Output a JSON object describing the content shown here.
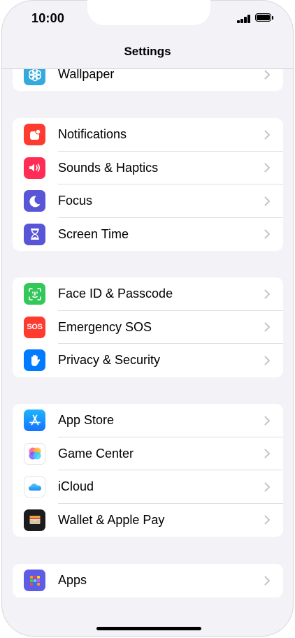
{
  "status_bar": {
    "time": "10:00"
  },
  "header": {
    "title": "Settings"
  },
  "groups": [
    {
      "rows": [
        {
          "label": "Wallpaper",
          "icon": "wallpaper-icon",
          "color": "#34aadc"
        }
      ]
    },
    {
      "rows": [
        {
          "label": "Notifications",
          "icon": "notifications-icon",
          "color": "#ff3b30"
        },
        {
          "label": "Sounds & Haptics",
          "icon": "speaker-icon",
          "color": "#ff2d55"
        },
        {
          "label": "Focus",
          "icon": "moon-icon",
          "color": "#5856d6"
        },
        {
          "label": "Screen Time",
          "icon": "hourglass-icon",
          "color": "#5856d6"
        }
      ]
    },
    {
      "rows": [
        {
          "label": "Face ID & Passcode",
          "icon": "face-id-icon",
          "color": "#34c759"
        },
        {
          "label": "Emergency SOS",
          "icon": "sos-icon",
          "color": "#ff3b30",
          "icon_text": "SOS"
        },
        {
          "label": "Privacy & Security",
          "icon": "hand-icon",
          "color": "#007aff"
        }
      ]
    },
    {
      "rows": [
        {
          "label": "App Store",
          "icon": "app-store-icon",
          "color": "#1a8cff"
        },
        {
          "label": "Game Center",
          "icon": "game-center-icon",
          "color": "#ffffff"
        },
        {
          "label": "iCloud",
          "icon": "icloud-icon",
          "color": "#ffffff"
        },
        {
          "label": "Wallet & Apple Pay",
          "icon": "wallet-icon",
          "color": "#1c1c1e"
        }
      ]
    },
    {
      "rows": [
        {
          "label": "Apps",
          "icon": "apps-icon",
          "color": "#5e5ce6"
        }
      ]
    }
  ]
}
